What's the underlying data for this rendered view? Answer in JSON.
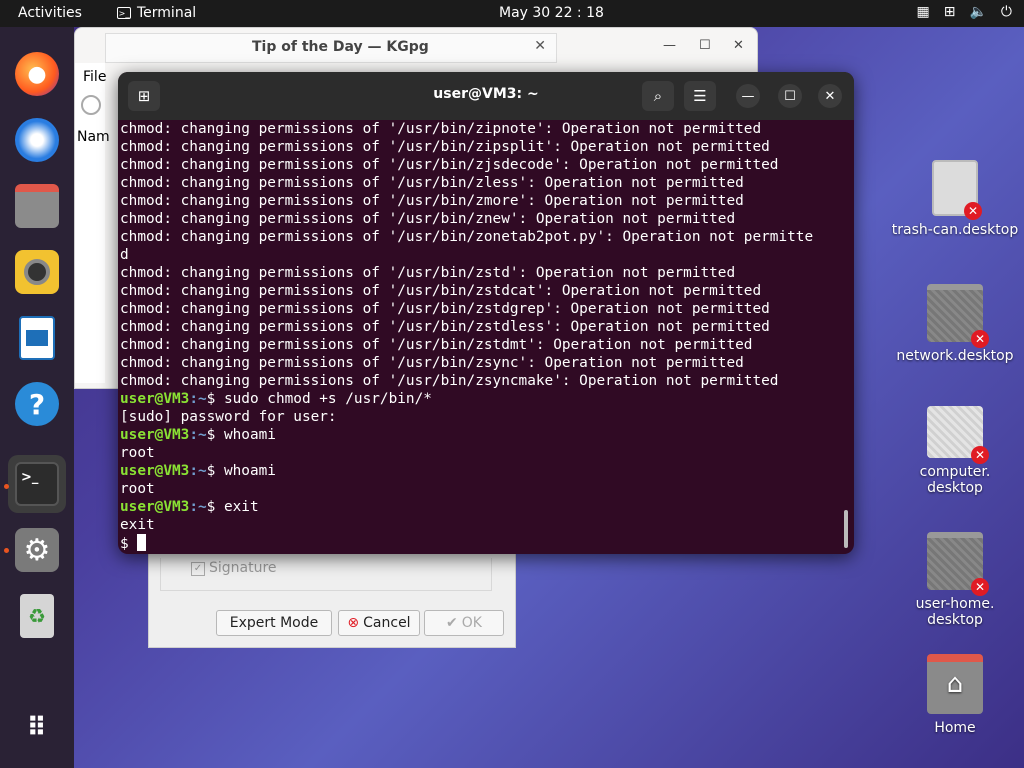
{
  "topbar": {
    "activities": "Activities",
    "app_name": "Terminal",
    "clock": "May 30  22 : 18",
    "tray": [
      "network-icon",
      "volume-icon",
      "power-icon"
    ]
  },
  "dock": {
    "items": [
      {
        "name": "firefox",
        "icon": "firefox-icon"
      },
      {
        "name": "thunderbird",
        "icon": "thunderbird-icon"
      },
      {
        "name": "files",
        "icon": "files-icon"
      },
      {
        "name": "rhythmbox",
        "icon": "rhythmbox-icon"
      },
      {
        "name": "writer",
        "icon": "writer-icon"
      },
      {
        "name": "help",
        "icon": "help-icon"
      },
      {
        "name": "terminal",
        "icon": "terminal-icon"
      },
      {
        "name": "settings",
        "icon": "settings-icon"
      },
      {
        "name": "trash",
        "icon": "trash-icon"
      },
      {
        "name": "show-apps",
        "icon": "grid-icon"
      }
    ]
  },
  "kgpg": {
    "title": "Tip of the Day — KGpg",
    "menu_file": "File",
    "col_name": "Nam",
    "signature_label": "Signature",
    "expert_mode": "Expert Mode",
    "cancel": "Cancel",
    "ok": "OK"
  },
  "terminal": {
    "title": "user@VM3: ~",
    "prompt_user": "user@VM3",
    "prompt_path": ":~",
    "lines": [
      {
        "text": "chmod: changing permissions of '/usr/bin/zipnote': Operation not permitted"
      },
      {
        "text": "chmod: changing permissions of '/usr/bin/zipsplit': Operation not permitted"
      },
      {
        "text": "chmod: changing permissions of '/usr/bin/zjsdecode': Operation not permitted"
      },
      {
        "text": "chmod: changing permissions of '/usr/bin/zless': Operation not permitted"
      },
      {
        "text": "chmod: changing permissions of '/usr/bin/zmore': Operation not permitted"
      },
      {
        "text": "chmod: changing permissions of '/usr/bin/znew': Operation not permitted"
      },
      {
        "text": "chmod: changing permissions of '/usr/bin/zonetab2pot.py': Operation not permitte"
      },
      {
        "text": "d"
      },
      {
        "text": "chmod: changing permissions of '/usr/bin/zstd': Operation not permitted"
      },
      {
        "text": "chmod: changing permissions of '/usr/bin/zstdcat': Operation not permitted"
      },
      {
        "text": "chmod: changing permissions of '/usr/bin/zstdgrep': Operation not permitted"
      },
      {
        "text": "chmod: changing permissions of '/usr/bin/zstdless': Operation not permitted"
      },
      {
        "text": "chmod: changing permissions of '/usr/bin/zstdmt': Operation not permitted"
      },
      {
        "text": "chmod: changing permissions of '/usr/bin/zsync': Operation not permitted"
      },
      {
        "text": "chmod: changing permissions of '/usr/bin/zsyncmake': Operation not permitted"
      },
      {
        "prompt": true,
        "text": "$ sudo chmod +s /usr/bin/*"
      },
      {
        "text": "[sudo] password for user:"
      },
      {
        "prompt": true,
        "text": "$ whoami"
      },
      {
        "text": "root"
      },
      {
        "prompt": true,
        "text": "$ whoami"
      },
      {
        "text": "root"
      },
      {
        "prompt": true,
        "text": "$ exit"
      },
      {
        "text": "exit"
      }
    ],
    "final_prompt": "$ "
  },
  "desktop": {
    "icons": [
      {
        "label": "trash-can.desktop",
        "icon": "trash-file-icon"
      },
      {
        "label": "network.desktop",
        "icon": "network-folder-icon"
      },
      {
        "label": "computer.\ndesktop",
        "icon": "computer-file-icon"
      },
      {
        "label": "user-home.\ndesktop",
        "icon": "home-folder-icon"
      },
      {
        "label": "Home",
        "icon": "home-icon"
      }
    ]
  }
}
